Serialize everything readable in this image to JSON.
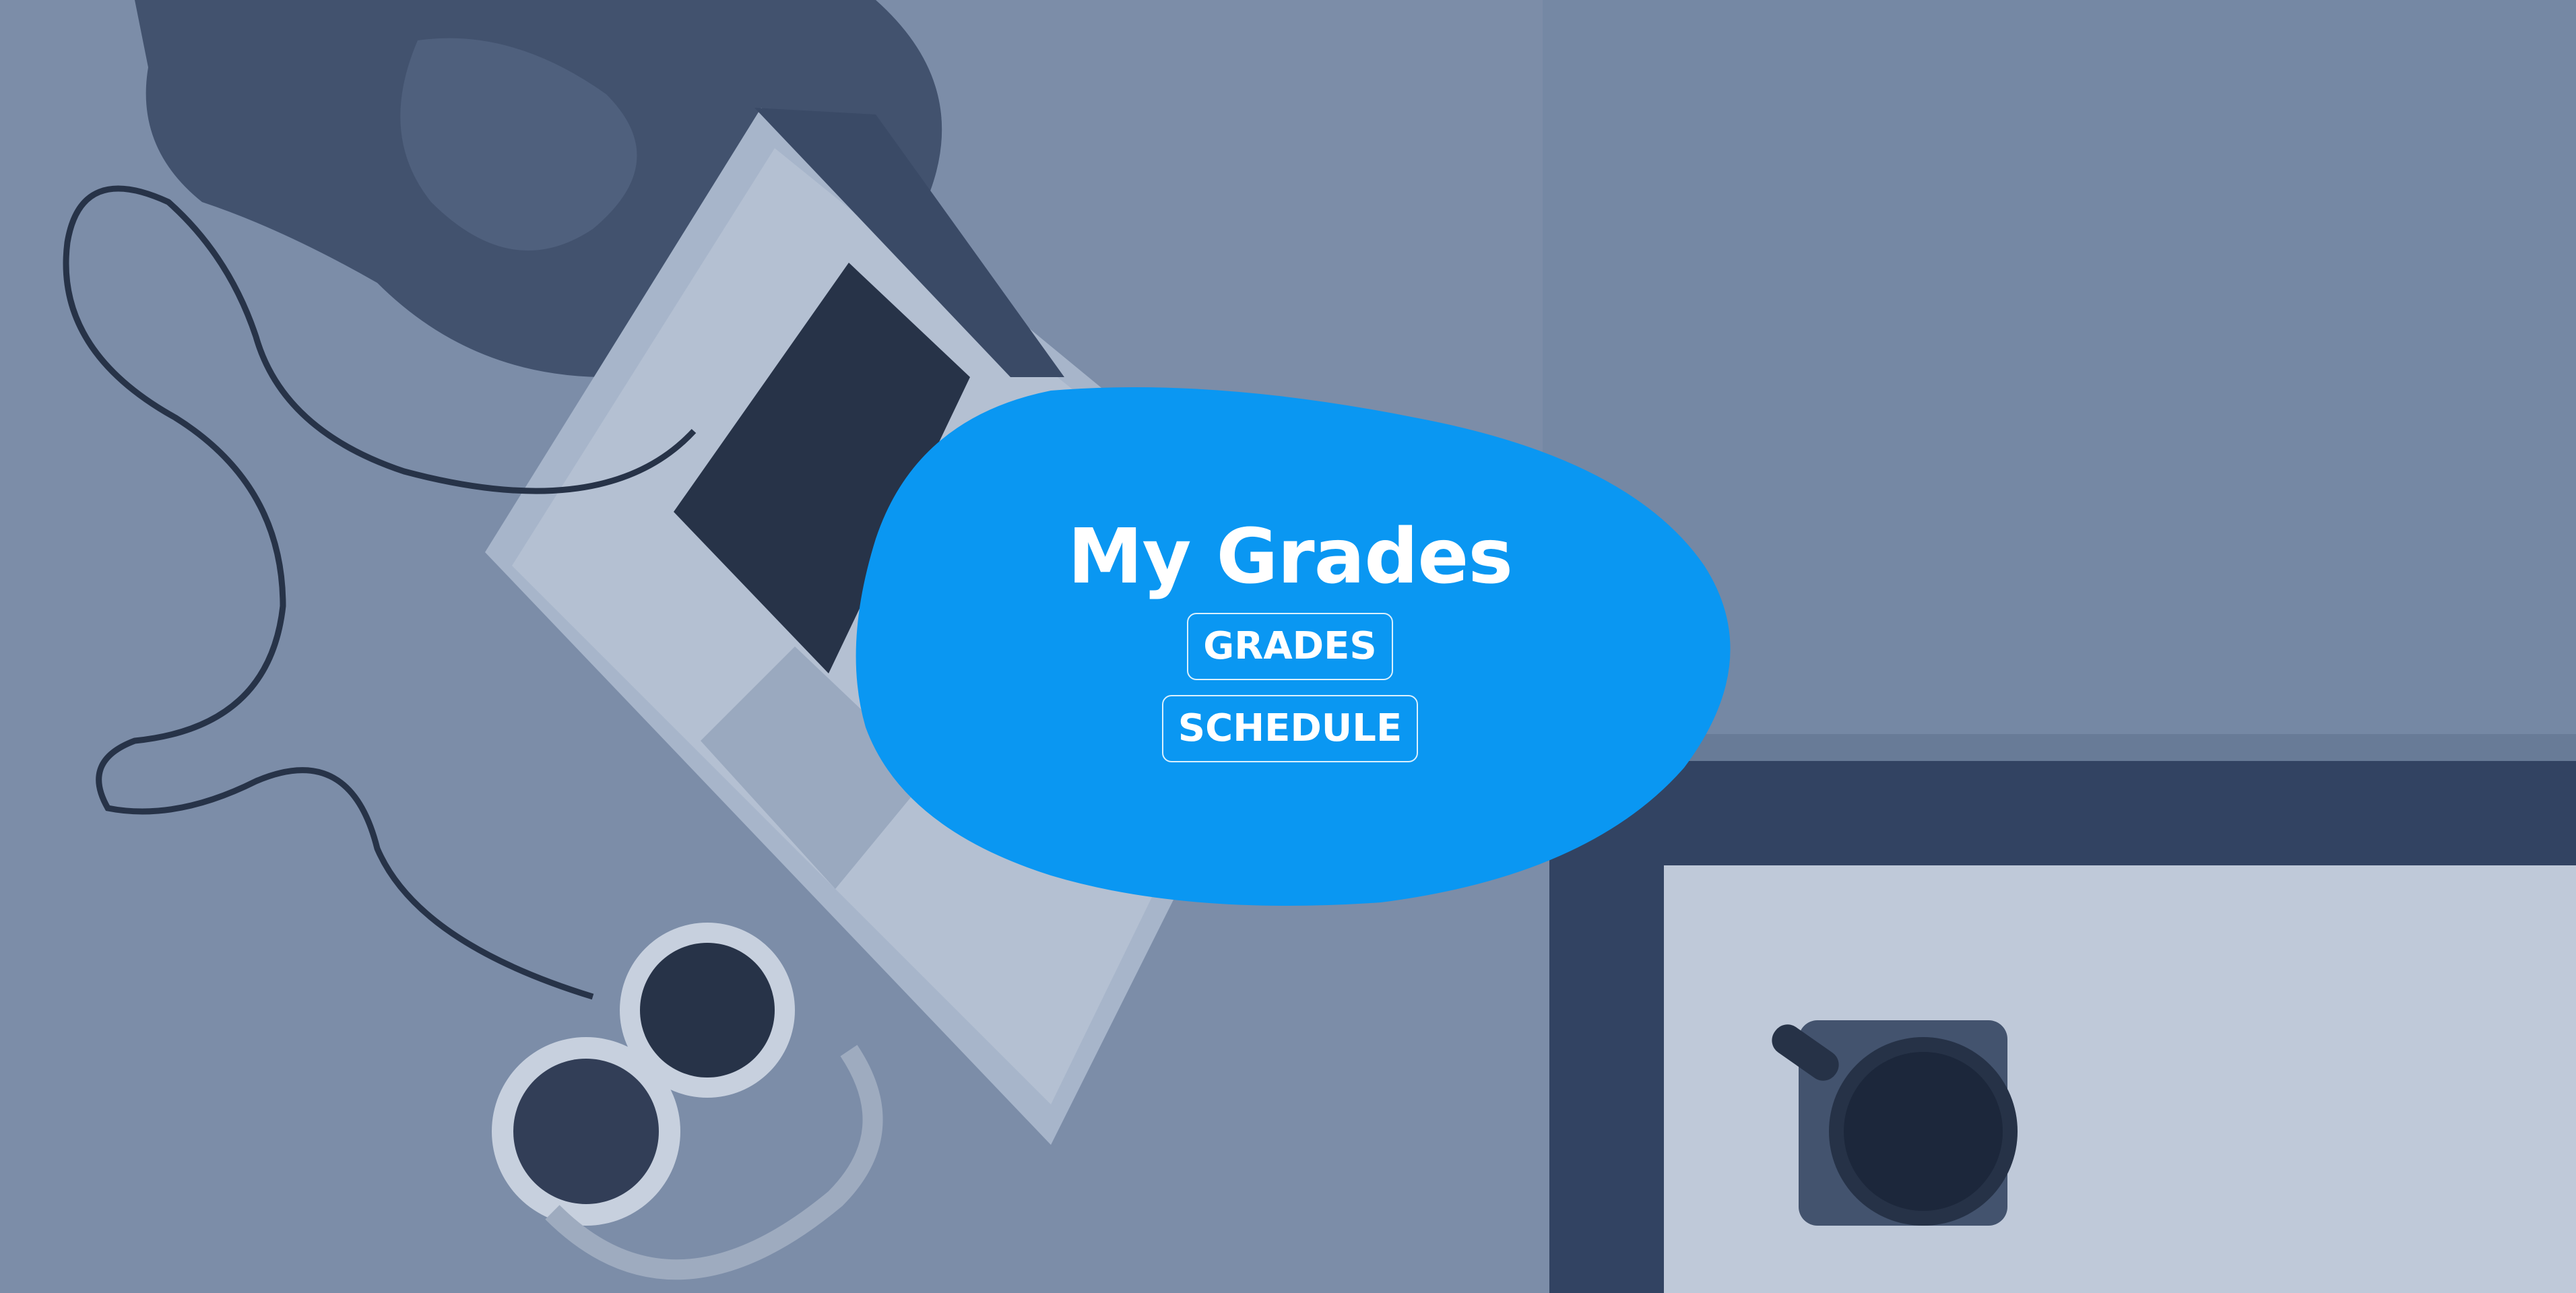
{
  "hero": {
    "title": "My Grades"
  },
  "nav": {
    "grades_label": "GRADES",
    "schedule_label": "SCHEDULE"
  },
  "colors": {
    "blob": "#0a97f2",
    "overlay": "#5b7196",
    "text": "#ffffff"
  }
}
